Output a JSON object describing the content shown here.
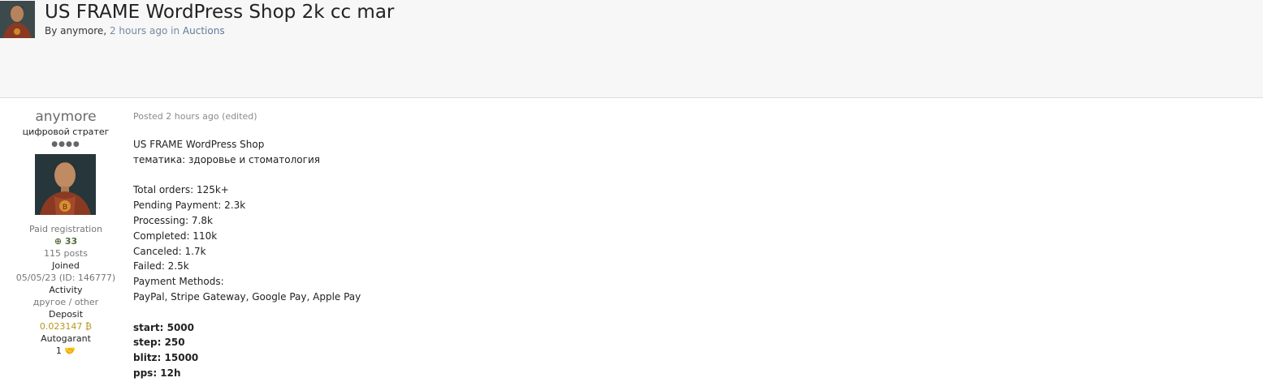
{
  "topic": {
    "title": "US FRAME WordPress Shop 2k cc mar",
    "by_prefix": "By",
    "author": "anymore",
    "sep": ",",
    "time": "2 hours ago",
    "in_word": "in",
    "forum": "Auctions"
  },
  "author_panel": {
    "name": "anymore",
    "rank": "цифровой стратег",
    "rank_dots": "●●●●",
    "group": "Paid registration",
    "reputation": "33",
    "posts": "115 posts",
    "joined_label": "Joined",
    "joined_value": "05/05/23 (ID: 146777)",
    "activity_label": "Activity",
    "activity_value": "другое / other",
    "deposit_label": "Deposit",
    "deposit_value": "0.023147 ₿",
    "autogarant_label": "Autogarant",
    "autogarant_value": "1"
  },
  "post": {
    "meta": "Posted 2 hours ago (edited)",
    "line1": "US FRAME WordPress Shop",
    "line2": "тематика: здоровье и стоматология",
    "total_orders": "Total orders: 125k+",
    "pending": "Pending Payment: 2.3k",
    "processing": "Processing: 7.8k",
    "completed": "Completed: 110k",
    "canceled": "Canceled: 1.7k",
    "failed": "Failed: 2.5k",
    "payment_label": "Payment Methods:",
    "payment_values": "PayPal, Stripe Gateway, Google Pay, Apple Pay",
    "start": "start: 5000",
    "step": "step: 250",
    "blitz": "blitz: 15000",
    "pps": "pps: 12h"
  },
  "colors": {
    "header_bg": "#f7f7f7",
    "link": "#5c7c9a",
    "reputation": "#4f6b3a",
    "deposit": "#b8971d"
  }
}
